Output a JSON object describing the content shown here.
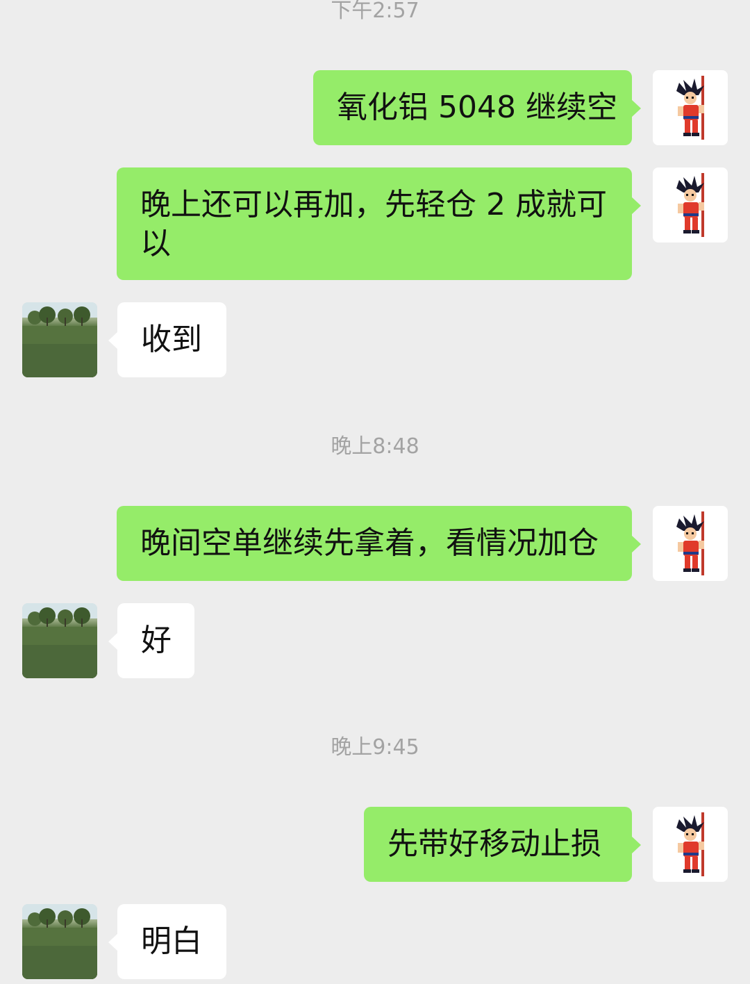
{
  "chat": {
    "timestamps": [
      "下午2:57",
      "晚上8:48",
      "晚上9:45"
    ],
    "messages": [
      {
        "sender": "me",
        "text": "氧化铝 5048 继续空"
      },
      {
        "sender": "me",
        "text": "晚上还可以再加，先轻仓 2 成就可\n以"
      },
      {
        "sender": "other",
        "text": "收到"
      },
      {
        "sender": "me",
        "text": "晚间空单继续先拿着，看情况加仓"
      },
      {
        "sender": "other",
        "text": "好"
      },
      {
        "sender": "me",
        "text": "先带好移动止损"
      },
      {
        "sender": "other",
        "text": "明白"
      }
    ]
  },
  "colors": {
    "background": "#ededed",
    "my_bubble": "#95ec69",
    "other_bubble": "#ffffff",
    "timestamp_text": "#a3a3a3"
  },
  "icons": {
    "my_avatar": "cartoon-boy-with-staff-avatar",
    "other_avatar": "grass-field-landscape-avatar"
  }
}
